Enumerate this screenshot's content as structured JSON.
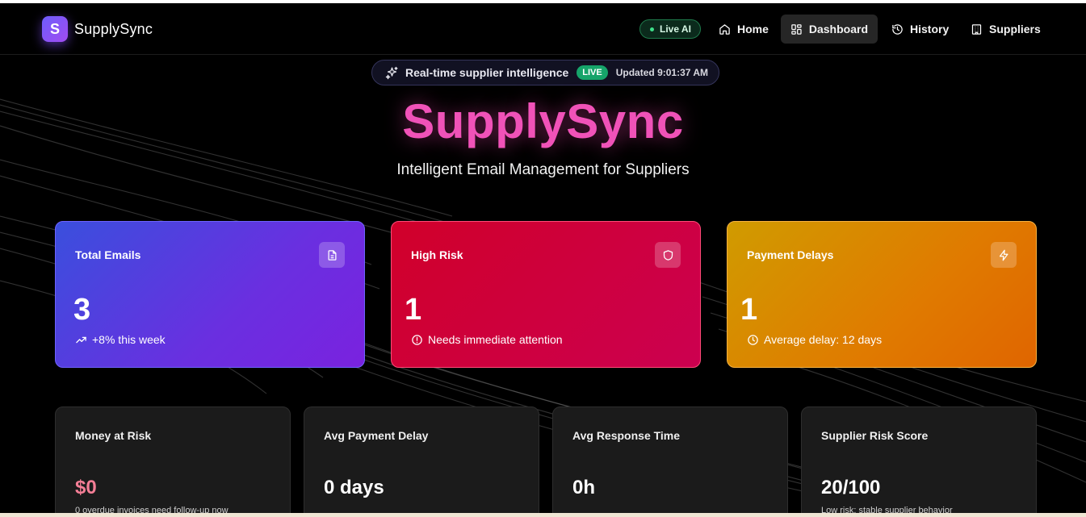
{
  "brand": {
    "letter": "S",
    "name": "SupplySync"
  },
  "nav": {
    "live_label": "Live AI",
    "items": [
      {
        "label": "Home",
        "icon": "home-icon"
      },
      {
        "label": "Dashboard",
        "icon": "dashboard-icon",
        "active": true
      },
      {
        "label": "History",
        "icon": "history-icon"
      },
      {
        "label": "Suppliers",
        "icon": "building-icon"
      }
    ]
  },
  "hero": {
    "pill_text": "Real-time supplier intelligence",
    "live_tag": "LIVE",
    "updated": "Updated 9:01:37 AM",
    "title": "SupplySync",
    "subtitle": "Intelligent Email Management for Suppliers"
  },
  "stats": [
    {
      "label": "Total Emails",
      "value": "3",
      "note": "+8% this week",
      "icon": "file-text-icon",
      "note_icon": "trending-up-icon"
    },
    {
      "label": "High Risk",
      "value": "1",
      "note": "Needs immediate attention",
      "icon": "shield-icon",
      "note_icon": "alert-circle-icon"
    },
    {
      "label": "Payment Delays",
      "value": "1",
      "note": "Average delay: 12 days",
      "icon": "zap-icon",
      "note_icon": "clock-icon"
    }
  ],
  "metrics": [
    {
      "label": "Money at Risk",
      "value": "$0",
      "note": "0 overdue invoices need follow-up now"
    },
    {
      "label": "Avg Payment Delay",
      "value": "0 days",
      "note": ""
    },
    {
      "label": "Avg Response Time",
      "value": "0h",
      "note": ""
    },
    {
      "label": "Supplier Risk Score",
      "value": "20/100",
      "note": "Low risk: stable supplier behavior"
    }
  ],
  "colors": {
    "accent_pink": "#f052b8",
    "card_blue": "#5a3ae0",
    "card_red": "#d0003a",
    "card_orange": "#e08a00",
    "live_green": "#16a46a",
    "money_pink": "#f47e96"
  }
}
